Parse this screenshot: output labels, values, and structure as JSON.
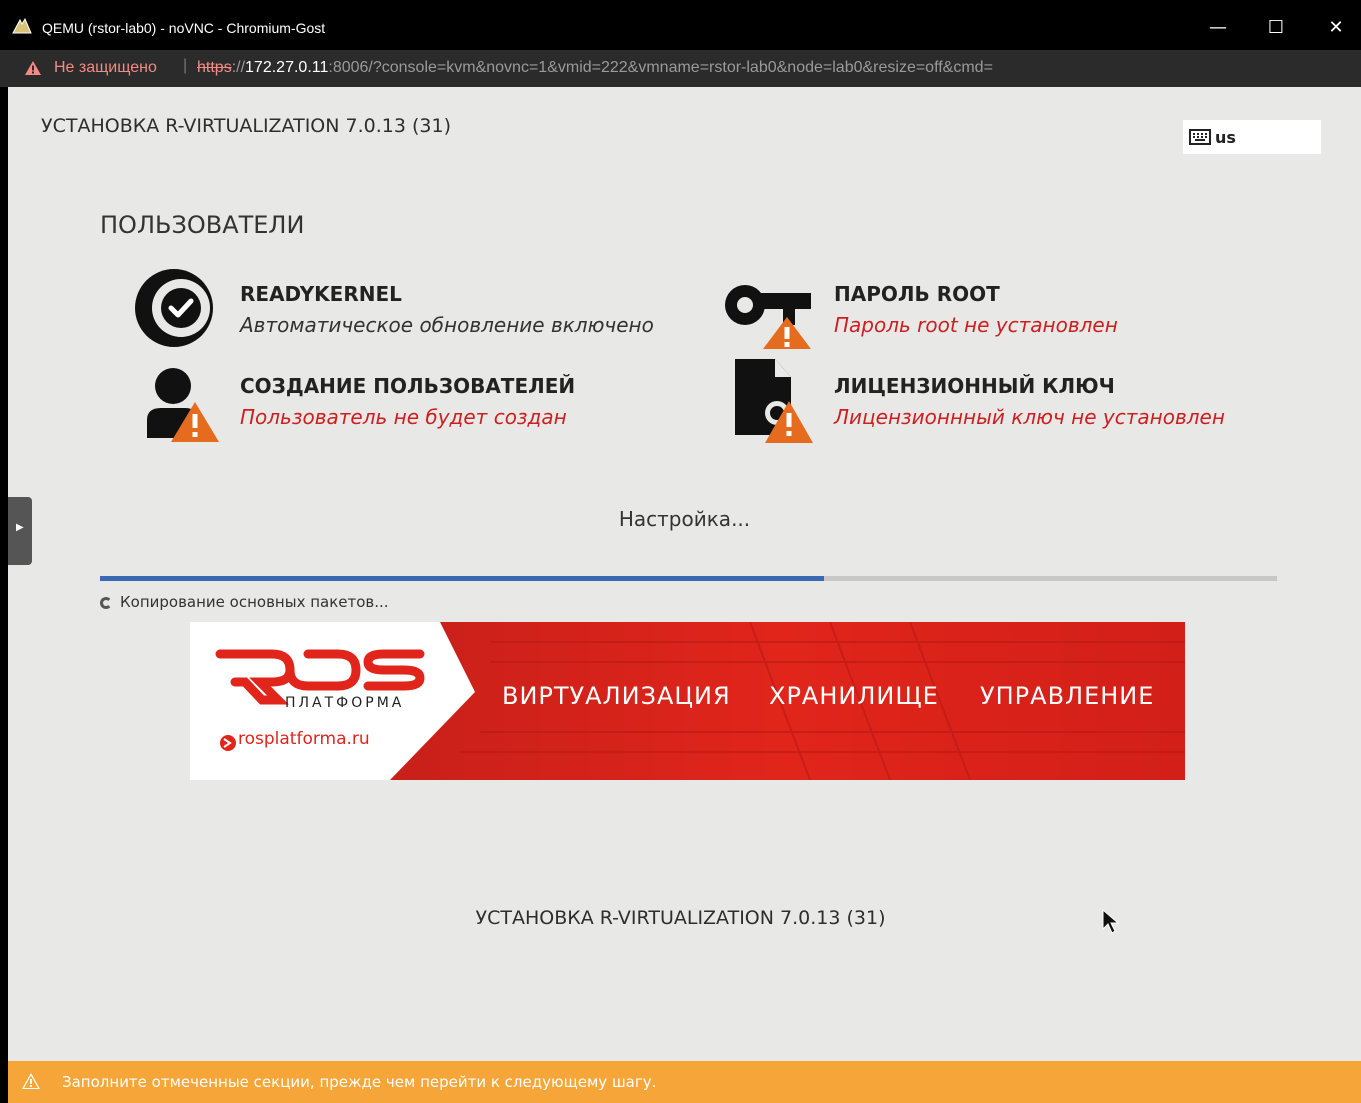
{
  "window": {
    "title": "QEMU (rstor-lab0) - noVNC - Chromium-Gost",
    "minimize": "—",
    "maximize": "☐",
    "close": "✕"
  },
  "address_bar": {
    "security_label": "Не защищено",
    "url_scheme": "https",
    "url_sep": "://",
    "url_host": "172.27.0.11",
    "url_rest": ":8006/?console=kvm&novnc=1&vmid=222&vmname=rstor-lab0&node=lab0&resize=off&cmd="
  },
  "installer": {
    "product_title": "УСТАНОВКА R-VIRTUALIZATION 7.0.13 (31)",
    "keyboard_layout": "us",
    "section_title": "ПОЛЬЗОВАТЕЛИ",
    "spokes": [
      {
        "label": "READYKERNEL",
        "status": "Автоматическое обновление включено",
        "icon": "readykernel-check-icon"
      },
      {
        "label": "ПАРОЛЬ ROOT",
        "status": "Пароль root не установлен",
        "icon": "key-warning-icon"
      },
      {
        "label": "СОЗДАНИЕ ПОЛЬЗОВАТЕЛЕЙ",
        "status": "Пользователь не будет создан",
        "icon": "user-warning-icon"
      },
      {
        "label": "ЛИЦЕНЗИОННЫЙ КЛЮЧ",
        "status": "Лицензионнный ключ не установлен",
        "icon": "license-warning-icon"
      }
    ],
    "progress_label": "Настройка...",
    "progress_fraction": 0.615,
    "step_text": "Копирование основных пакетов...",
    "footer_title": "УСТАНОВКА R-VIRTUALIZATION 7.0.13 (31)",
    "warning_message": "Заполните отмеченные секции, прежде чем перейти к следующему шагу."
  },
  "banner": {
    "logo_text": "ROS",
    "logo_sub": "ПЛАТФОРМА",
    "site": "rosplatforma.ru",
    "words": [
      "ВИРТУАЛИЗАЦИЯ",
      "ХРАНИЛИЩЕ",
      "УПРАВЛЕНИЕ"
    ]
  },
  "colors": {
    "warning_text": "#cc1f1f",
    "progress": "#3a6ab5",
    "banner_red": "#e1251b",
    "warning_bar": "#f6a638"
  }
}
